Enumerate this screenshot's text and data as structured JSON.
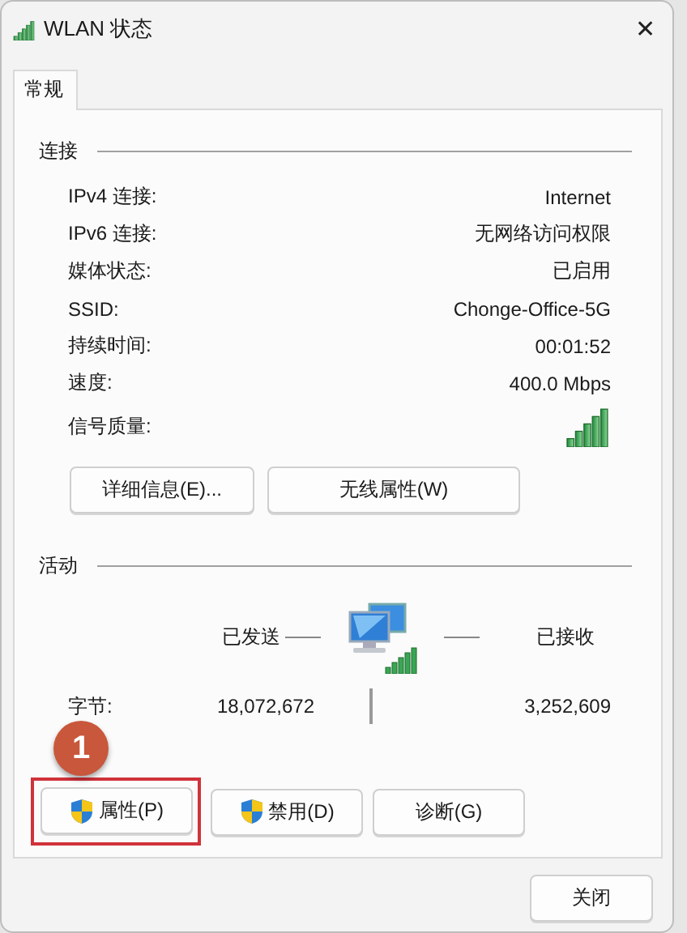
{
  "window": {
    "title": "WLAN 状态",
    "close": "✕"
  },
  "tabs": [
    {
      "label": "常规",
      "selected": true
    }
  ],
  "connection": {
    "heading": "连接",
    "rows": [
      {
        "kind": "text",
        "label": "IPv4 连接:",
        "value": "Internet"
      },
      {
        "kind": "text",
        "label": "IPv6 连接:",
        "value": "无网络访问权限"
      },
      {
        "kind": "text",
        "label": "媒体状态:",
        "value": "已启用"
      },
      {
        "kind": "text",
        "label": "SSID:",
        "value": "Chonge-Office-5G"
      },
      {
        "kind": "text",
        "label": "持续时间:",
        "value": "00:01:52"
      },
      {
        "kind": "text",
        "label": "速度:",
        "value": "400.0 Mbps"
      },
      {
        "kind": "signal",
        "label": "信号质量:"
      }
    ],
    "buttons": [
      "详细信息(E)...",
      "无线属性(W)"
    ]
  },
  "activity": {
    "heading": "活动",
    "sent_label": "已发送",
    "received_label": "已接收",
    "bytes_label": "字节:",
    "bytes_sent": "18,072,672",
    "bytes_received": "3,252,609"
  },
  "buttons": [
    {
      "label": "属性(P)",
      "shield": true,
      "highlighted": true
    },
    {
      "label": "禁用(D)",
      "shield": true,
      "highlighted": false
    },
    {
      "label": "诊断(G)",
      "shield": false,
      "highlighted": false
    }
  ],
  "annotation": {
    "badge": "1"
  },
  "close_button": "关闭"
}
